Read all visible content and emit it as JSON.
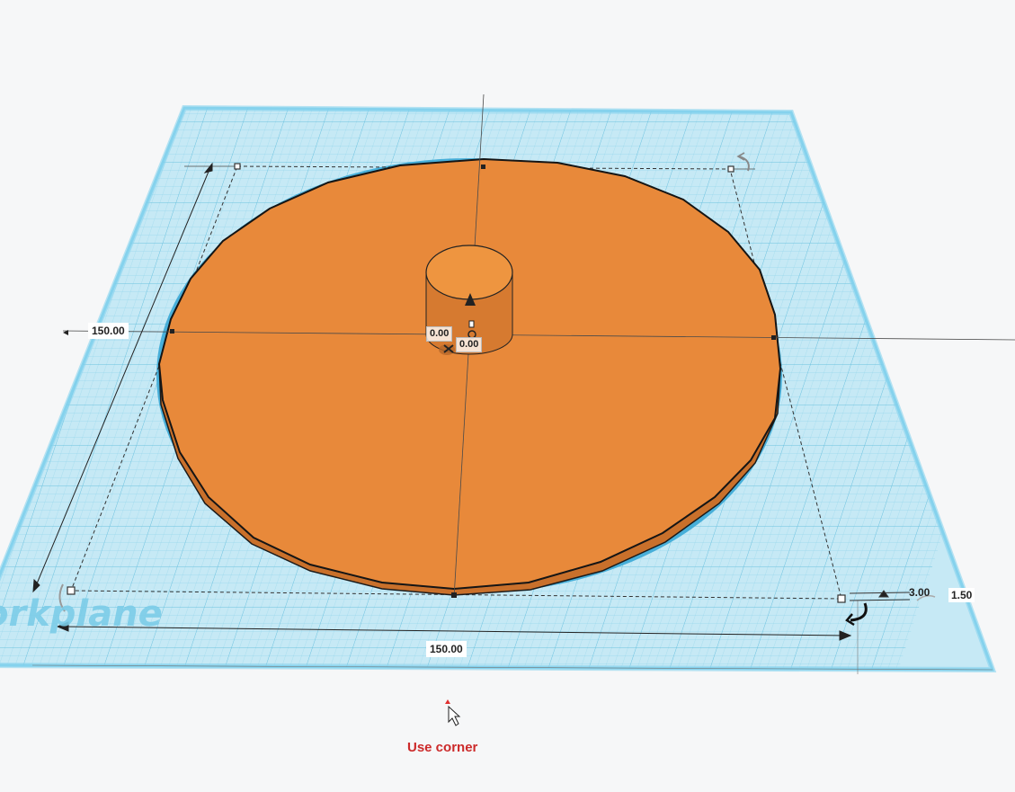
{
  "workplane": {
    "label": "Workplane",
    "visible_label_fragment": "orkplane"
  },
  "dimensions": {
    "width": "150.00",
    "depth": "150.00",
    "height_small": "3.00",
    "height_offset": "1.50"
  },
  "coordinates": {
    "x": "0.00",
    "y": "0.00"
  },
  "hint_text": "Use corner",
  "colors": {
    "background": "#f6f7f8",
    "workplane_fill": "#bfe6f3",
    "grid_line": "#7fcbe3",
    "shape_orange": "#e8883a",
    "hint_red": "#cc2a2a"
  },
  "icons": {
    "rotate": "rotate-arrow-icon",
    "cursor": "mouse-pointer-icon",
    "move_up": "move-up-cone-icon"
  }
}
